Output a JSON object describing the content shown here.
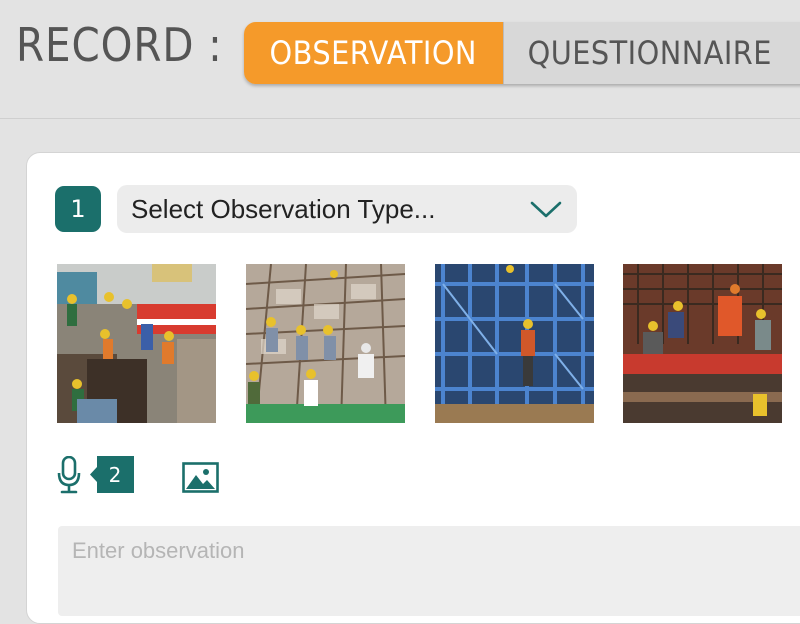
{
  "header": {
    "record_label": "RECORD :",
    "tabs": [
      {
        "label": "OBSERVATION",
        "active": true
      },
      {
        "label": "QUESTIONNAIRE",
        "active": false
      }
    ]
  },
  "form": {
    "step_number": "1",
    "observation_type": {
      "selected": "Select Observation Type...",
      "icon": "chevron-down-icon"
    },
    "photos": [
      {
        "name": "construction-photo-trench"
      },
      {
        "name": "construction-photo-slab"
      },
      {
        "name": "construction-photo-scaffolding"
      },
      {
        "name": "construction-photo-rebar"
      }
    ],
    "voice_note_count": "2",
    "observation_input": {
      "value": "",
      "placeholder": "Enter observation"
    }
  },
  "colors": {
    "accent": "#f59a2a",
    "teal": "#1b6f6b",
    "background": "#e3e3e3"
  }
}
